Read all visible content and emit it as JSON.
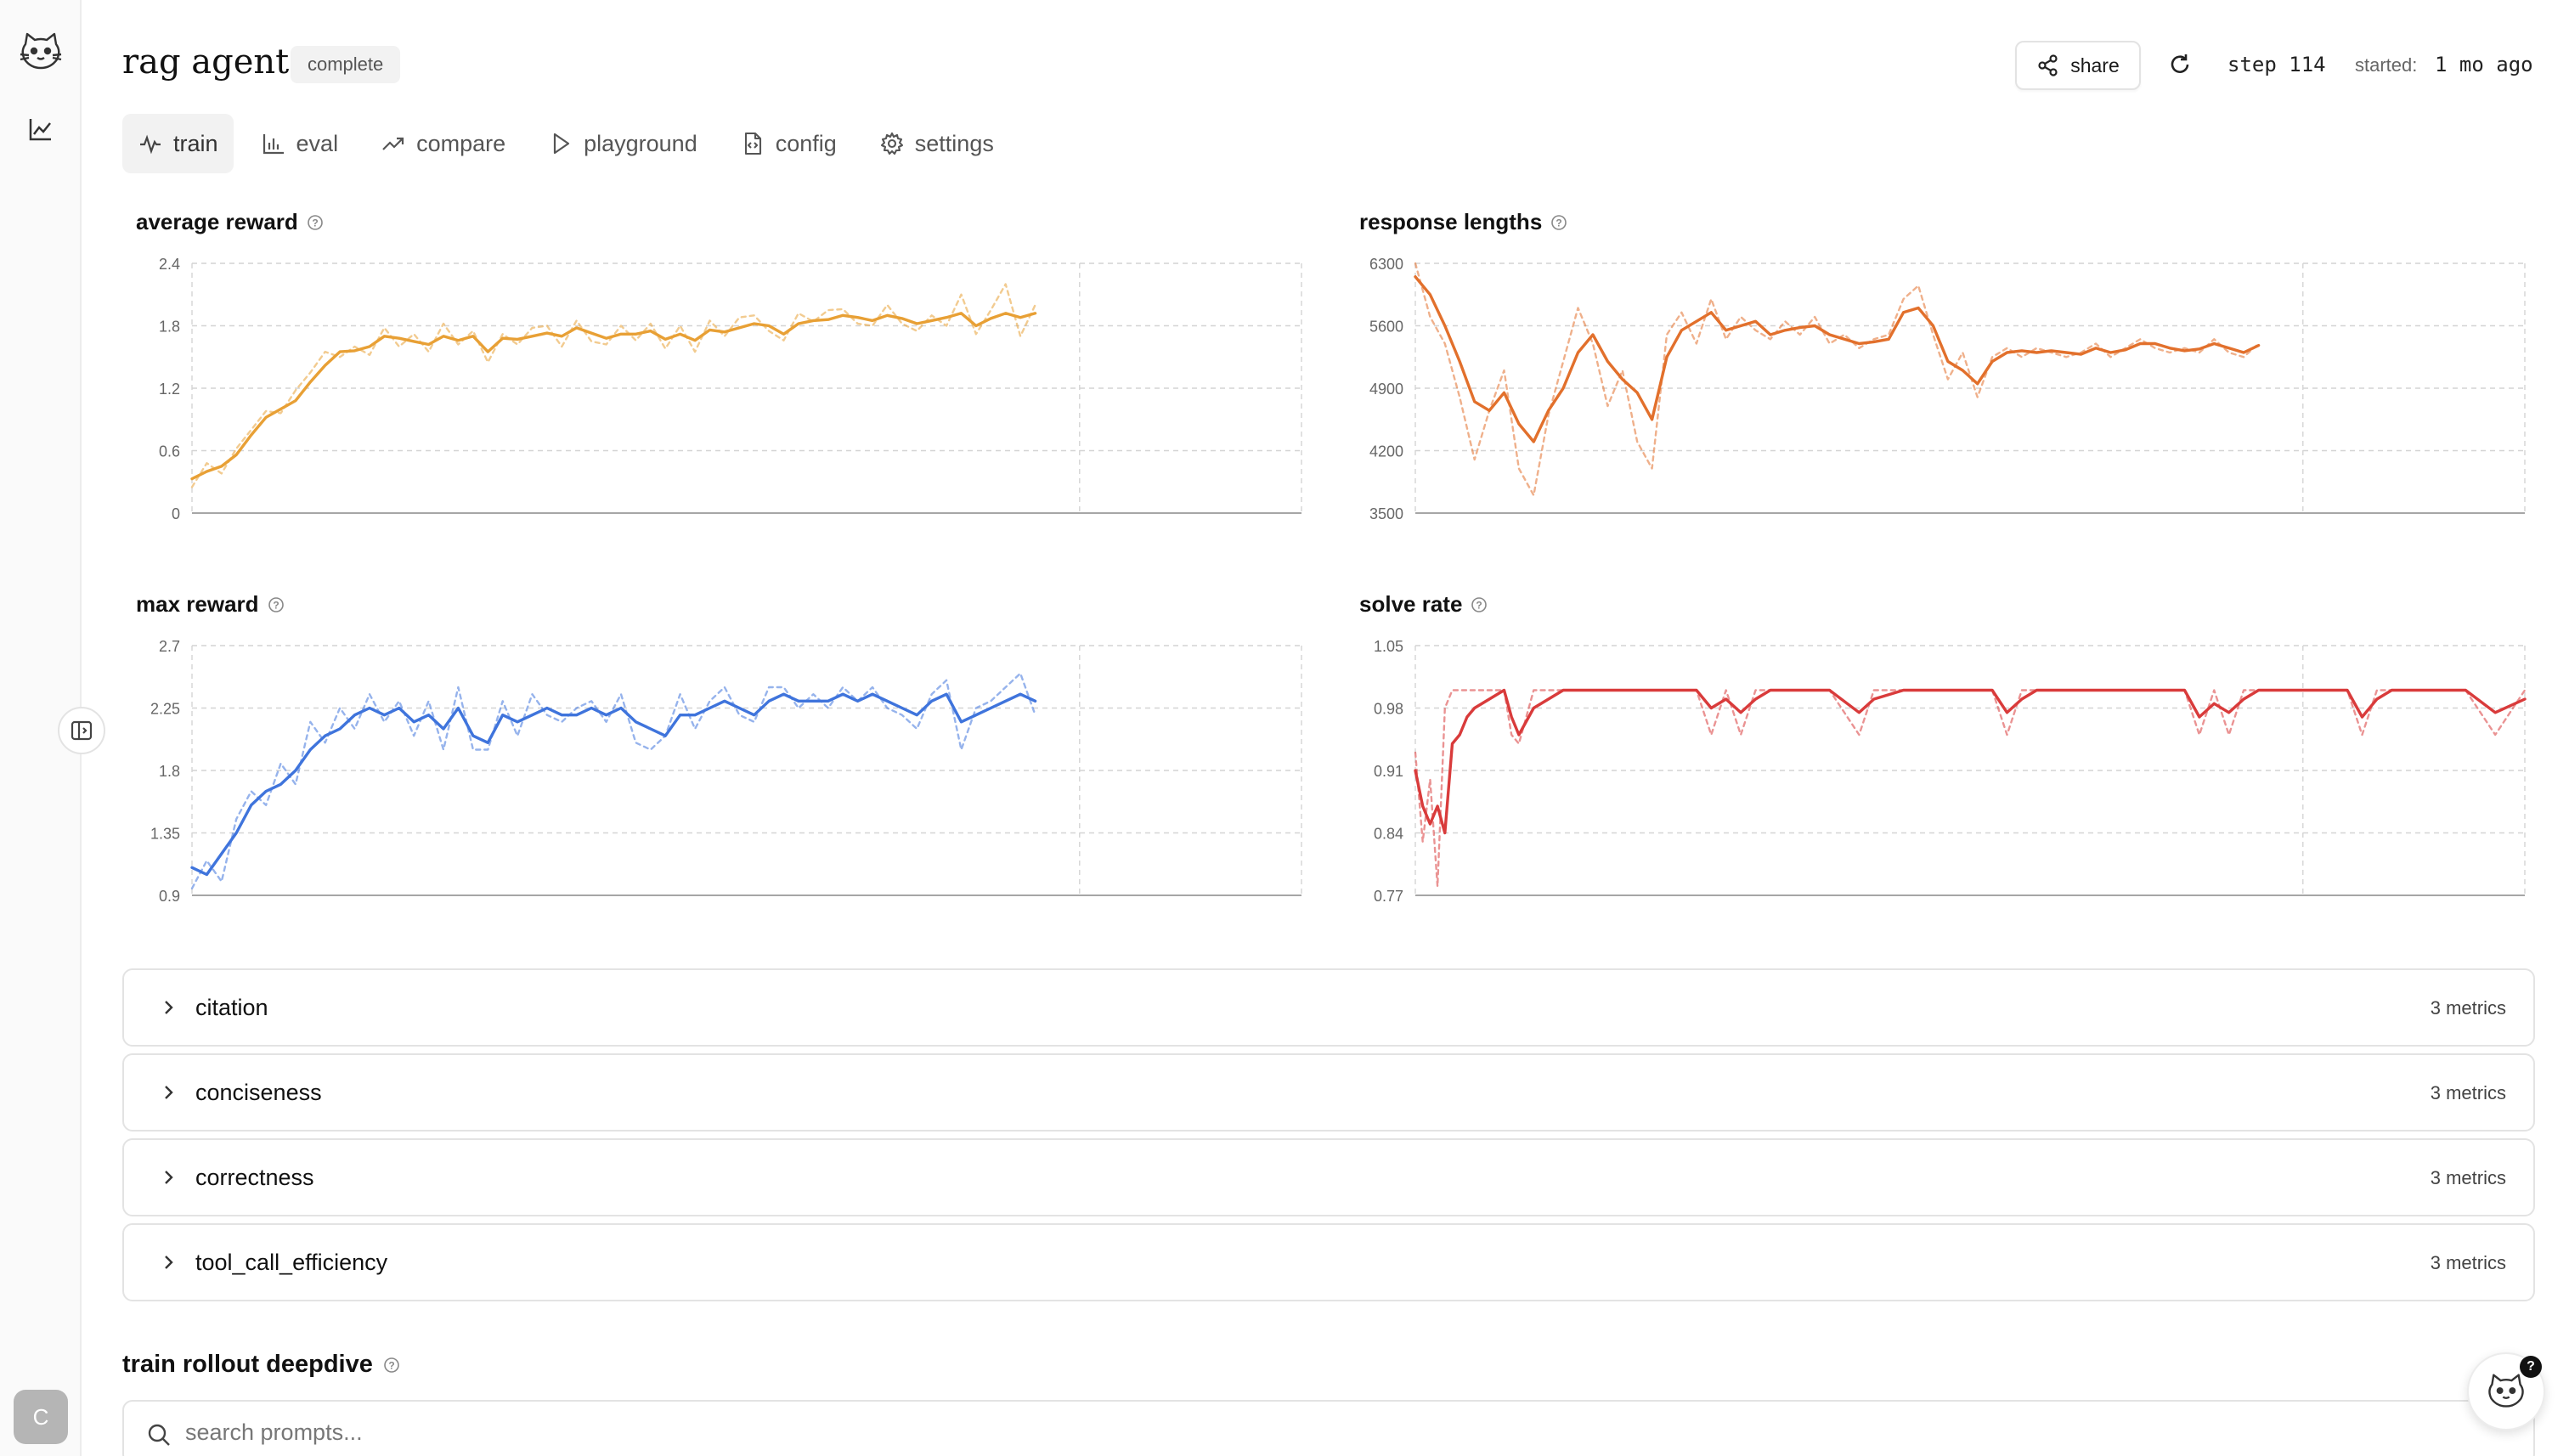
{
  "run": {
    "title": "rag agent",
    "status": "complete",
    "share_label": "share",
    "step_label": "step 114",
    "started_label": "started:",
    "started_value": "1 mo ago"
  },
  "tabs": [
    {
      "label": "train",
      "icon": "activity-icon",
      "active": true
    },
    {
      "label": "eval",
      "icon": "bar-chart-icon",
      "active": false
    },
    {
      "label": "compare",
      "icon": "trending-up-icon",
      "active": false
    },
    {
      "label": "playground",
      "icon": "play-icon",
      "active": false
    },
    {
      "label": "config",
      "icon": "file-code-icon",
      "active": false
    },
    {
      "label": "settings",
      "icon": "gear-icon",
      "active": false
    }
  ],
  "sidebar": {
    "avatar_initial": "C"
  },
  "chart_data": [
    {
      "type": "line",
      "title": "average reward",
      "color": "#e8a035",
      "yticks": [
        "0",
        "0.6",
        "1.2",
        "1.8",
        "2.4"
      ],
      "ylim": [
        0,
        2.4
      ],
      "xticks": [
        "0",
        "120"
      ],
      "xlim": [
        0,
        150
      ],
      "grid": true,
      "series": [
        {
          "style": "smoothed",
          "x": [
            0,
            2,
            4,
            6,
            8,
            10,
            12,
            14,
            16,
            18,
            20,
            22,
            24,
            26,
            28,
            30,
            32,
            34,
            36,
            38,
            40,
            42,
            44,
            46,
            48,
            50,
            52,
            54,
            56,
            58,
            60,
            62,
            64,
            66,
            68,
            70,
            72,
            74,
            76,
            78,
            80,
            82,
            84,
            86,
            88,
            90,
            92,
            94,
            96,
            98,
            100,
            102,
            104,
            106,
            108,
            110,
            112,
            114
          ],
          "values": [
            0.33,
            0.4,
            0.45,
            0.56,
            0.75,
            0.92,
            1.0,
            1.08,
            1.26,
            1.42,
            1.55,
            1.56,
            1.6,
            1.7,
            1.68,
            1.65,
            1.62,
            1.7,
            1.66,
            1.7,
            1.55,
            1.68,
            1.67,
            1.7,
            1.73,
            1.7,
            1.78,
            1.73,
            1.68,
            1.72,
            1.72,
            1.75,
            1.67,
            1.72,
            1.66,
            1.76,
            1.74,
            1.78,
            1.82,
            1.8,
            1.72,
            1.82,
            1.85,
            1.86,
            1.9,
            1.88,
            1.85,
            1.9,
            1.87,
            1.82,
            1.85,
            1.88,
            1.92,
            1.8,
            1.87,
            1.92,
            1.88,
            1.92
          ]
        },
        {
          "style": "raw",
          "x": [
            0,
            2,
            4,
            6,
            8,
            10,
            12,
            14,
            16,
            18,
            20,
            22,
            24,
            26,
            28,
            30,
            32,
            34,
            36,
            38,
            40,
            42,
            44,
            46,
            48,
            50,
            52,
            54,
            56,
            58,
            60,
            62,
            64,
            66,
            68,
            70,
            72,
            74,
            76,
            78,
            80,
            82,
            84,
            86,
            88,
            90,
            92,
            94,
            96,
            98,
            100,
            102,
            104,
            106,
            108,
            110,
            112,
            114
          ],
          "values": [
            0.25,
            0.48,
            0.38,
            0.62,
            0.8,
            0.98,
            0.96,
            1.18,
            1.35,
            1.55,
            1.5,
            1.6,
            1.52,
            1.78,
            1.6,
            1.72,
            1.55,
            1.82,
            1.62,
            1.75,
            1.45,
            1.72,
            1.62,
            1.78,
            1.8,
            1.6,
            1.85,
            1.65,
            1.62,
            1.8,
            1.66,
            1.82,
            1.58,
            1.8,
            1.55,
            1.85,
            1.7,
            1.88,
            1.9,
            1.75,
            1.66,
            1.92,
            1.84,
            1.95,
            1.96,
            1.82,
            1.8,
            2.0,
            1.82,
            1.75,
            1.9,
            1.8,
            2.1,
            1.72,
            1.95,
            2.2,
            1.7,
            2.0
          ]
        }
      ]
    },
    {
      "type": "line",
      "title": "response lengths",
      "color": "#e2702c",
      "yticks": [
        "3500",
        "4200",
        "4900",
        "5600",
        "6300"
      ],
      "ylim": [
        3500,
        6300
      ],
      "xticks": [
        "0",
        "120"
      ],
      "xlim": [
        0,
        150
      ],
      "grid": true,
      "series": [
        {
          "style": "smoothed",
          "x": [
            0,
            2,
            4,
            6,
            8,
            10,
            12,
            14,
            16,
            18,
            20,
            22,
            24,
            26,
            28,
            30,
            32,
            34,
            36,
            38,
            40,
            42,
            44,
            46,
            48,
            50,
            52,
            54,
            56,
            58,
            60,
            62,
            64,
            66,
            68,
            70,
            72,
            74,
            76,
            78,
            80,
            82,
            84,
            86,
            88,
            90,
            92,
            94,
            96,
            98,
            100,
            102,
            104,
            106,
            108,
            110,
            112,
            114
          ],
          "values": [
            6150,
            5950,
            5600,
            5200,
            4750,
            4650,
            4850,
            4500,
            4300,
            4650,
            4900,
            5300,
            5500,
            5200,
            5000,
            4850,
            4550,
            5250,
            5550,
            5650,
            5750,
            5550,
            5600,
            5650,
            5500,
            5550,
            5580,
            5600,
            5500,
            5450,
            5400,
            5420,
            5450,
            5750,
            5800,
            5600,
            5200,
            5100,
            4950,
            5200,
            5300,
            5320,
            5300,
            5320,
            5300,
            5280,
            5350,
            5300,
            5330,
            5400,
            5400,
            5350,
            5320,
            5340,
            5400,
            5350,
            5300,
            5380
          ]
        },
        {
          "style": "raw",
          "x": [
            0,
            2,
            4,
            6,
            8,
            10,
            12,
            14,
            16,
            18,
            20,
            22,
            24,
            26,
            28,
            30,
            32,
            34,
            36,
            38,
            40,
            42,
            44,
            46,
            48,
            50,
            52,
            54,
            56,
            58,
            60,
            62,
            64,
            66,
            68,
            70,
            72,
            74,
            76,
            78,
            80,
            82,
            84,
            86,
            88,
            90,
            92,
            94,
            96,
            98,
            100,
            102,
            104,
            106,
            108,
            110,
            112,
            114
          ],
          "values": [
            6300,
            5700,
            5400,
            4800,
            4100,
            4650,
            5100,
            4000,
            3700,
            4600,
            5200,
            5800,
            5400,
            4700,
            5100,
            4300,
            4000,
            5500,
            5750,
            5400,
            5900,
            5450,
            5700,
            5550,
            5450,
            5650,
            5500,
            5700,
            5400,
            5500,
            5350,
            5450,
            5500,
            5900,
            6050,
            5500,
            5000,
            5300,
            4800,
            5250,
            5350,
            5250,
            5350,
            5300,
            5250,
            5300,
            5400,
            5250,
            5350,
            5450,
            5350,
            5300,
            5350,
            5300,
            5450,
            5300,
            5250,
            5400
          ]
        }
      ]
    },
    {
      "type": "line",
      "title": "max reward",
      "color": "#3f74dc",
      "yticks": [
        "0.9",
        "1.35",
        "1.8",
        "2.25",
        "2.7"
      ],
      "ylim": [
        0.9,
        2.7
      ],
      "xticks": [
        "0",
        "120"
      ],
      "xlim": [
        0,
        150
      ],
      "grid": true,
      "series": [
        {
          "style": "smoothed",
          "x": [
            0,
            2,
            4,
            6,
            8,
            10,
            12,
            14,
            16,
            18,
            20,
            22,
            24,
            26,
            28,
            30,
            32,
            34,
            36,
            38,
            40,
            42,
            44,
            46,
            48,
            50,
            52,
            54,
            56,
            58,
            60,
            62,
            64,
            66,
            68,
            70,
            72,
            74,
            76,
            78,
            80,
            82,
            84,
            86,
            88,
            90,
            92,
            94,
            96,
            98,
            100,
            102,
            104,
            106,
            108,
            110,
            112,
            114
          ],
          "values": [
            1.1,
            1.05,
            1.2,
            1.35,
            1.55,
            1.65,
            1.7,
            1.8,
            1.95,
            2.05,
            2.1,
            2.2,
            2.25,
            2.2,
            2.25,
            2.15,
            2.2,
            2.1,
            2.25,
            2.05,
            2.0,
            2.2,
            2.15,
            2.2,
            2.25,
            2.2,
            2.2,
            2.25,
            2.2,
            2.25,
            2.15,
            2.1,
            2.05,
            2.2,
            2.2,
            2.25,
            2.3,
            2.25,
            2.2,
            2.3,
            2.35,
            2.3,
            2.3,
            2.3,
            2.35,
            2.3,
            2.35,
            2.3,
            2.25,
            2.2,
            2.3,
            2.35,
            2.15,
            2.2,
            2.25,
            2.3,
            2.35,
            2.3
          ]
        },
        {
          "style": "raw",
          "x": [
            0,
            2,
            4,
            6,
            8,
            10,
            12,
            14,
            16,
            18,
            20,
            22,
            24,
            26,
            28,
            30,
            32,
            34,
            36,
            38,
            40,
            42,
            44,
            46,
            48,
            50,
            52,
            54,
            56,
            58,
            60,
            62,
            64,
            66,
            68,
            70,
            72,
            74,
            76,
            78,
            80,
            82,
            84,
            86,
            88,
            90,
            92,
            94,
            96,
            98,
            100,
            102,
            104,
            106,
            108,
            110,
            112,
            114
          ],
          "values": [
            0.95,
            1.15,
            1.0,
            1.45,
            1.65,
            1.55,
            1.85,
            1.7,
            2.15,
            2.0,
            2.25,
            2.1,
            2.35,
            2.15,
            2.3,
            2.05,
            2.3,
            1.95,
            2.4,
            1.95,
            1.95,
            2.3,
            2.05,
            2.35,
            2.2,
            2.15,
            2.25,
            2.3,
            2.15,
            2.35,
            2.0,
            1.95,
            2.05,
            2.35,
            2.1,
            2.3,
            2.4,
            2.2,
            2.15,
            2.4,
            2.4,
            2.25,
            2.35,
            2.25,
            2.4,
            2.3,
            2.4,
            2.25,
            2.2,
            2.1,
            2.35,
            2.45,
            1.95,
            2.25,
            2.3,
            2.4,
            2.5,
            2.2
          ]
        }
      ]
    },
    {
      "type": "line",
      "title": "solve rate",
      "color": "#d93b3b",
      "yticks": [
        "0.77",
        "0.84",
        "0.91",
        "0.98",
        "1.05"
      ],
      "ylim": [
        0.77,
        1.05
      ],
      "xticks": [
        "0",
        "120"
      ],
      "xlim": [
        0,
        150
      ],
      "grid": true,
      "series": [
        {
          "style": "smoothed",
          "x": [
            0,
            1,
            2,
            3,
            4,
            5,
            6,
            7,
            8,
            10,
            12,
            13,
            14,
            16,
            18,
            20,
            22,
            26,
            30,
            34,
            38,
            40,
            42,
            44,
            46,
            48,
            50,
            52,
            56,
            60,
            62,
            64,
            66,
            70,
            74,
            78,
            80,
            82,
            84,
            88,
            90,
            92,
            96,
            100,
            104,
            106,
            108,
            110,
            112,
            114,
            116,
            118,
            122,
            126,
            128,
            130,
            132,
            136,
            142,
            146,
            150
          ],
          "values": [
            0.91,
            0.87,
            0.85,
            0.87,
            0.84,
            0.94,
            0.95,
            0.97,
            0.98,
            0.99,
            1.0,
            0.97,
            0.95,
            0.98,
            0.99,
            1.0,
            1.0,
            1.0,
            1.0,
            1.0,
            1.0,
            0.98,
            0.99,
            0.975,
            0.99,
            1.0,
            1.0,
            1.0,
            1.0,
            0.975,
            0.99,
            0.995,
            1.0,
            1.0,
            1.0,
            1.0,
            0.975,
            0.99,
            1.0,
            1.0,
            1.0,
            1.0,
            1.0,
            1.0,
            1.0,
            0.97,
            0.985,
            0.975,
            0.99,
            1.0,
            1.0,
            1.0,
            1.0,
            1.0,
            0.97,
            0.99,
            1.0,
            1.0,
            1.0,
            0.975,
            0.99
          ]
        },
        {
          "style": "raw",
          "x": [
            0,
            1,
            2,
            3,
            4,
            5,
            6,
            7,
            8,
            10,
            12,
            13,
            14,
            16,
            18,
            20,
            22,
            26,
            30,
            34,
            38,
            40,
            42,
            44,
            46,
            48,
            50,
            52,
            56,
            60,
            62,
            64,
            66,
            70,
            74,
            78,
            80,
            82,
            84,
            88,
            90,
            92,
            96,
            100,
            104,
            106,
            108,
            110,
            112,
            114,
            116,
            118,
            122,
            126,
            128,
            130,
            132,
            136,
            142,
            146,
            150
          ],
          "values": [
            0.93,
            0.83,
            0.9,
            0.78,
            0.98,
            1.0,
            1.0,
            1.0,
            1.0,
            1.0,
            1.0,
            0.95,
            0.94,
            1.0,
            1.0,
            1.0,
            1.0,
            1.0,
            1.0,
            1.0,
            1.0,
            0.95,
            1.0,
            0.95,
            1.0,
            1.0,
            1.0,
            1.0,
            1.0,
            0.95,
            1.0,
            1.0,
            1.0,
            1.0,
            1.0,
            1.0,
            0.95,
            1.0,
            1.0,
            1.0,
            1.0,
            1.0,
            1.0,
            1.0,
            1.0,
            0.95,
            1.0,
            0.95,
            1.0,
            1.0,
            1.0,
            1.0,
            1.0,
            1.0,
            0.95,
            1.0,
            1.0,
            1.0,
            1.0,
            0.95,
            1.0
          ]
        }
      ]
    }
  ],
  "accordions": [
    {
      "label": "citation",
      "count": "3 metrics"
    },
    {
      "label": "conciseness",
      "count": "3 metrics"
    },
    {
      "label": "correctness",
      "count": "3 metrics"
    },
    {
      "label": "tool_call_efficiency",
      "count": "3 metrics"
    }
  ],
  "deepdive": {
    "title": "train rollout deepdive",
    "search_placeholder": "search prompts..."
  },
  "help": {
    "badge": "?"
  }
}
